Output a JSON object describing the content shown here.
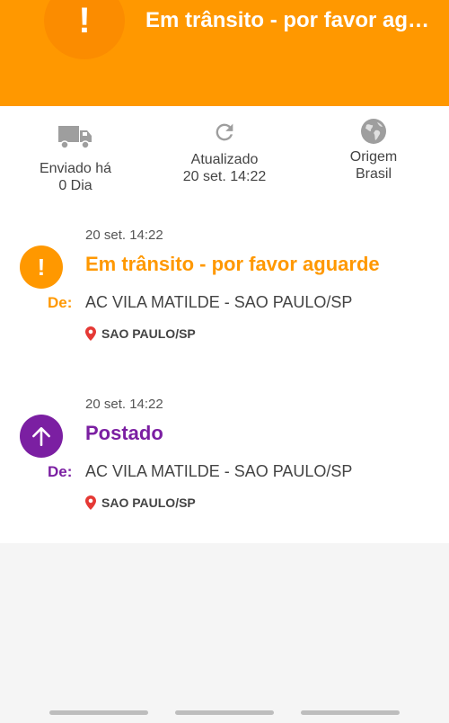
{
  "header": {
    "title": "Em trânsito - por favor aguarde",
    "icon": "exclamation-icon",
    "color": "#ff9800"
  },
  "stats": {
    "sent": {
      "icon": "truck-icon",
      "line1": "Enviado há",
      "line2": "0 Dia"
    },
    "updated": {
      "icon": "refresh-icon",
      "line1": "Atualizado",
      "line2": "20 set. 14:22"
    },
    "origin": {
      "icon": "globe-icon",
      "line1": "Origem",
      "line2": "Brasil"
    }
  },
  "events": [
    {
      "time": "20 set. 14:22",
      "icon": "exclamation-icon",
      "status": "Em trânsito - por favor aguarde",
      "color": "#ff9800",
      "from_label": "De:",
      "from": "AC VILA MATILDE - SAO PAULO/SP",
      "location_icon": "location-pin-icon",
      "location": "SAO PAULO/SP"
    },
    {
      "time": "20 set. 14:22",
      "icon": "arrow-up-icon",
      "status": "Postado",
      "color": "#7b1fa2",
      "from_label": "De:",
      "from": "AC VILA MATILDE - SAO PAULO/SP",
      "location_icon": "location-pin-icon",
      "location": "SAO PAULO/SP"
    }
  ]
}
